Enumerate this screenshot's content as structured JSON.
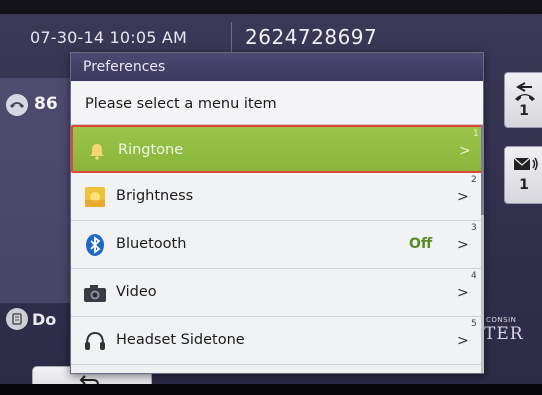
{
  "status_bar": {
    "datetime": "07-30-14 10:05 AM",
    "phone_number": "2624728697"
  },
  "line": {
    "ext": "86"
  },
  "dnd": {
    "label": "Do"
  },
  "right_buttons": [
    {
      "icon": "call-return-icon",
      "count": "1"
    },
    {
      "icon": "voicemail-icon",
      "count": "1"
    }
  ],
  "brand": {
    "small": "CONSIN",
    "big": "TER"
  },
  "dialog": {
    "title": "Preferences",
    "prompt": "Please select a menu item"
  },
  "menu_items": [
    {
      "label": "Ringtone",
      "value": "",
      "chevron": ">",
      "number": "1",
      "icon": "bell-icon",
      "selected": true
    },
    {
      "label": "Brightness",
      "value": "",
      "chevron": ">",
      "number": "2",
      "icon": "brightness-icon",
      "selected": false
    },
    {
      "label": "Bluetooth",
      "value": "Off",
      "chevron": ">",
      "number": "3",
      "icon": "bluetooth-icon",
      "selected": false
    },
    {
      "label": "Video",
      "value": "",
      "chevron": ">",
      "number": "4",
      "icon": "camera-icon",
      "selected": false
    },
    {
      "label": "Headset Sidetone",
      "value": "",
      "chevron": ">",
      "number": "5",
      "icon": "headset-icon",
      "selected": false
    }
  ],
  "colors": {
    "selected_bg": "#9bc54b",
    "selected_border": "#e2453a",
    "title_bar": "#4d4a72",
    "value_green": "#5a8a22"
  }
}
